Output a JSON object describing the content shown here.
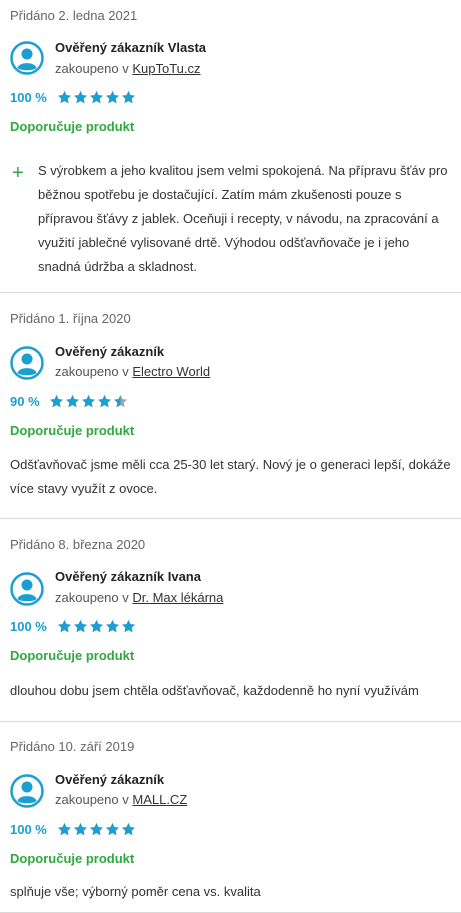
{
  "reviews": [
    {
      "date": "Přidáno 2. ledna 2021",
      "author": "Ověřený zákazník Vlasta",
      "bought_prefix": "zakoupeno v",
      "shop": "KupToTu.cz",
      "percent": "100 %",
      "rating": 5,
      "recommend": "Doporučuje produkt",
      "pros_icon": "plus-icon",
      "text": "S výrobkem a jeho kvalitou jsem velmi spokojená. Na přípravu šťáv pro běžnou spotřebu je dostačující. Zatím mám zkušenosti pouze s přípravou šťávy z jablek. Oceňuji i recepty, v návodu, na zpracování a využití jablečné vylisované drtě. Výhodou odšťavňovače je i jeho snadná údržba a skladnost."
    },
    {
      "date": "Přidáno 1. října 2020",
      "author": "Ověřený zákazník",
      "bought_prefix": "zakoupeno v",
      "shop": "Electro World",
      "percent": "90 %",
      "rating": 4.5,
      "recommend": "Doporučuje produkt",
      "text": "Odšťavňovač jsme měli cca 25-30 let starý. Nový je o generaci lepší, dokáže více stavy využít z ovoce."
    },
    {
      "date": "Přidáno 8. března 2020",
      "author": "Ověřený zákazník Ivana",
      "bought_prefix": "zakoupeno v",
      "shop": "Dr. Max lékárna",
      "percent": "100 %",
      "rating": 5,
      "recommend": "Doporučuje produkt",
      "text": "dlouhou dobu jsem chtěla odšťavňovač, každodenně ho nyní využívám"
    },
    {
      "date": "Přidáno 10. září 2019",
      "author": "Ověřený zákazník",
      "bought_prefix": "zakoupeno v",
      "shop": "MALL.CZ",
      "percent": "100 %",
      "rating": 5,
      "recommend": "Doporučuje produkt",
      "text": "splňuje vše; výborný poměr cena vs. kvalita"
    }
  ],
  "colors": {
    "accent": "#1a9fd0",
    "recommend": "#2fa83f",
    "star_empty": "#9aa3ab"
  }
}
